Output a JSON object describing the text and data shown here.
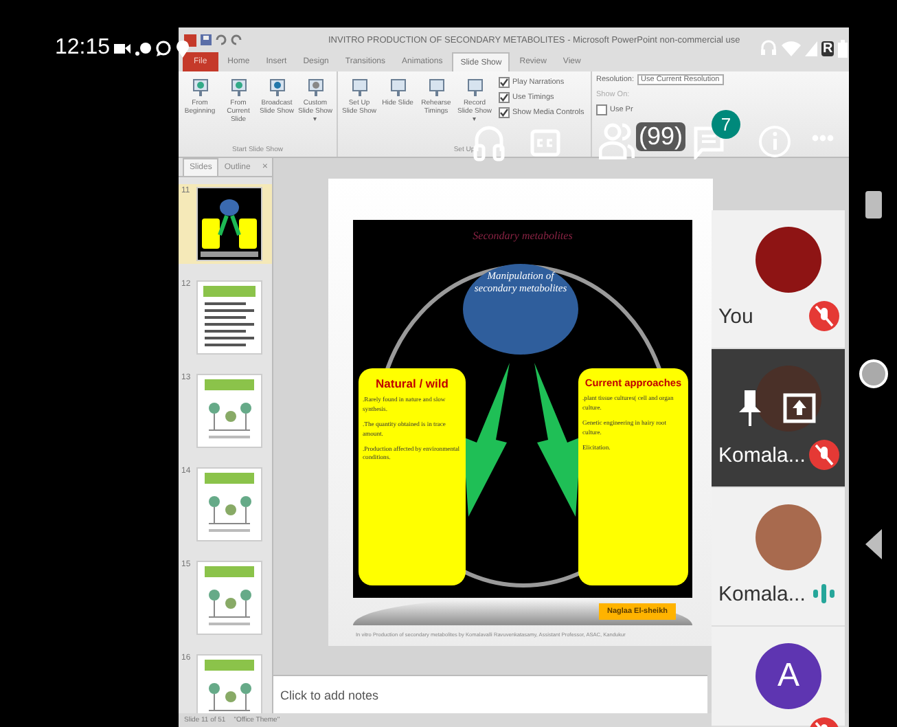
{
  "status_bar": {
    "time": "12:15",
    "network": "R"
  },
  "presentation_window": {
    "title": "INVITRO PRODUCTION OF SECONDARY METABOLITES - Microsoft PowerPoint non-commercial use",
    "tabs": [
      {
        "label": "File",
        "selected": false,
        "kind": "file"
      },
      {
        "label": "Home",
        "selected": false,
        "kind": "tab"
      },
      {
        "label": "Insert",
        "selected": false,
        "kind": "tab"
      },
      {
        "label": "Design",
        "selected": false,
        "kind": "tab"
      },
      {
        "label": "Transitions",
        "selected": false,
        "kind": "tab"
      },
      {
        "label": "Animations",
        "selected": false,
        "kind": "tab"
      },
      {
        "label": "Slide Show",
        "selected": true,
        "kind": "tab"
      },
      {
        "label": "Review",
        "selected": false,
        "kind": "tab"
      },
      {
        "label": "View",
        "selected": false,
        "kind": "tab"
      }
    ],
    "ribbon": {
      "groups": [
        {
          "label": "Start Slide Show",
          "buttons": [
            "From Beginning",
            "From Current Slide",
            "Broadcast Slide Show",
            "Custom Slide Show ▾"
          ]
        },
        {
          "label": "Set Up",
          "buttons": [
            "Set Up Slide Show",
            "Hide Slide",
            "Rehearse Timings",
            "Record Slide Show ▾"
          ],
          "options": [
            {
              "label": "Play Narrations",
              "checked": true
            },
            {
              "label": "Use Timings",
              "checked": true
            },
            {
              "label": "Show Media Controls",
              "checked": true
            }
          ]
        }
      ],
      "monitors": {
        "resolution_label": "Resolution:",
        "resolution": "Use Current Resolution",
        "show_on": "Show On:",
        "presenter_view": {
          "label": "Use Pr",
          "checked": false
        }
      }
    },
    "slides_pane": {
      "tabs": [
        {
          "label": "Slides",
          "selected": true
        },
        {
          "label": "Outline",
          "selected": false
        }
      ],
      "close": "×",
      "thumbnails": [
        {
          "number": "11",
          "selected": true,
          "kind": "dark"
        },
        {
          "number": "12",
          "selected": false,
          "kind": "bullets"
        },
        {
          "number": "13",
          "selected": false,
          "kind": "figure"
        },
        {
          "number": "14",
          "selected": false,
          "kind": "figure"
        },
        {
          "number": "15",
          "selected": false,
          "kind": "figure"
        },
        {
          "number": "16",
          "selected": false,
          "kind": "figure"
        }
      ]
    },
    "slide": {
      "title": "Secondary metabolites",
      "center": "Manipulation of secondary metabolites",
      "boxes": [
        {
          "heading": "Natural / wild",
          "points": [
            ".Rarely found in nature and slow synthesis.",
            ".The quantity obtained is in trace amount.",
            ".Production affected by environmental conditions."
          ]
        },
        {
          "heading": "Current approaches",
          "points": [
            ".plant tissue cultures( cell and organ culture.",
            "Genetic engineering in hairy root culture.",
            "Elicitation."
          ]
        }
      ],
      "author": "Naglaa El-sheikh",
      "footer": "In vitro Production of secondary metabolites by Komalavalli Ravuvenkatasamy, Assistant Professor, ASAC, Kandukur"
    },
    "notes_placeholder": "Click to add notes",
    "status": [
      "Slide 11 of 51",
      "\"Office Theme\""
    ]
  },
  "call_controls": {
    "participants_count": "(99)",
    "chat_badge": "7"
  },
  "participants": [
    {
      "name": "You",
      "muted": true,
      "pinned": false,
      "color": "#8e1414"
    },
    {
      "name": "Komala...",
      "muted": true,
      "pinned": true,
      "color": "#4a3028"
    },
    {
      "name": "Komala...",
      "muted": false,
      "pinned": false,
      "color": "#a86a4e"
    },
    {
      "avatar_text": "A",
      "muted": true,
      "pinned": false,
      "color": "#5e35b1"
    }
  ]
}
